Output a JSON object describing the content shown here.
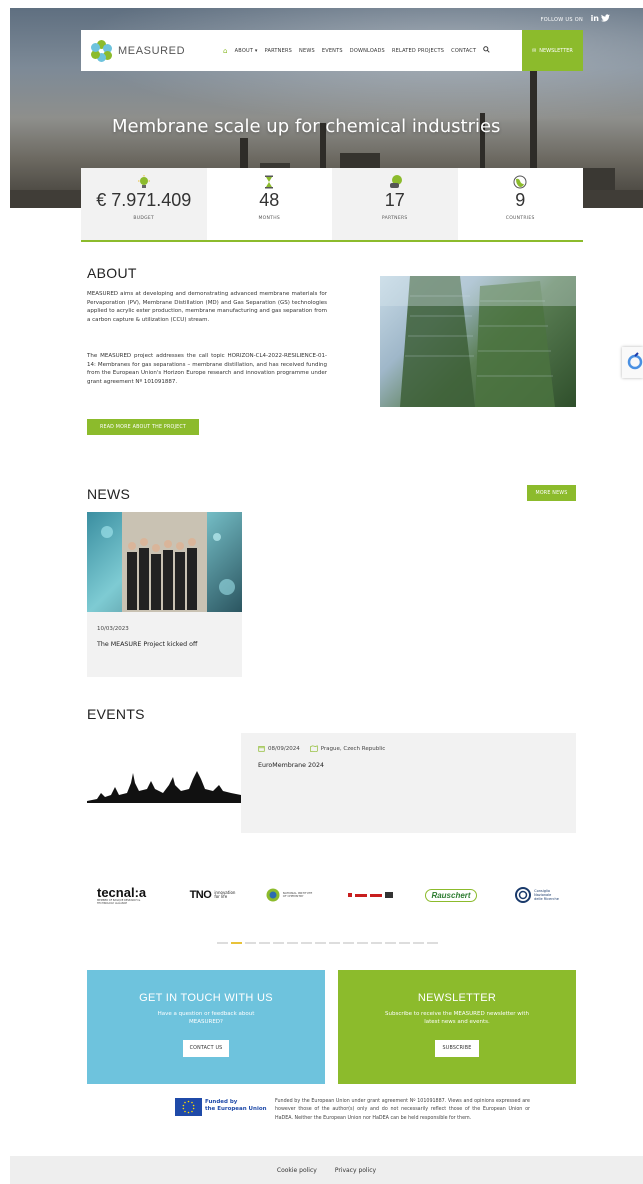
{
  "header": {
    "follow_label": "FOLLOW US ON",
    "logo_text": "MEASURED",
    "menu": [
      "ABOUT ▾",
      "PARTNERS",
      "NEWS",
      "EVENTS",
      "DOWNLOADS",
      "RELATED PROJECTS",
      "CONTACT"
    ],
    "newsletter_label": "NEWSLETTER",
    "hero_title": "Membrane scale up for chemical industries"
  },
  "stats": [
    {
      "value": "€ 7.971.409",
      "label": "BUDGET",
      "icon": "lightbulb-icon"
    },
    {
      "value": "48",
      "label": "MONTHS",
      "icon": "hourglass-icon"
    },
    {
      "value": "17",
      "label": "PARTNERS",
      "icon": "handshake-icon"
    },
    {
      "value": "9",
      "label": "COUNTRIES",
      "icon": "globe-icon"
    }
  ],
  "about": {
    "title": "ABOUT",
    "p1": "MEASURED aims at developing and demonstrating advanced membrane materials for Pervaporation (PV), Membrane Distillation (MD) and Gas Separation (GS) technologies applied to acrylic ester production, membrane manufacturing and gas separation from a carbon capture & utilization (CCU) stream.",
    "p2": "The MEASURED project addresses the call topic HORIZON-CL4-2022-RESILIENCE-01-14: Membranes for gas separations – membrane distillation, and has received funding from the European Union's Horizon Europe research and innovation programme under grant agreement Nº 101091887.",
    "button": "READ MORE ABOUT THE PROJECT"
  },
  "news": {
    "title": "NEWS",
    "more": "MORE NEWS",
    "items": [
      {
        "date": "10/03/2023",
        "headline": "The MEASURE Project kicked off"
      }
    ]
  },
  "events": {
    "title": "EVENTS",
    "items": [
      {
        "date": "08/09/2024",
        "location": "Prague, Czech Republic",
        "name": "EuroMembrane 2024"
      }
    ]
  },
  "partners": {
    "tecnalia": "tecnal:a",
    "tecnalia_sub": "MEMBER OF BASQUE RESEARCH & TECHNOLOGY ALLIANCE",
    "tno": "TNO",
    "tno_sub1": "innovation",
    "tno_sub2": "for life",
    "nic_text1": "NATIONAL INSTITUTE",
    "nic_text2": "OF CHEMISTRY",
    "rauschert": "Rauschert",
    "cnr1": "Consiglio",
    "cnr2": "Nazionale",
    "cnr3": "delle Ricerche"
  },
  "cta": {
    "contact_title": "GET IN TOUCH WITH US",
    "contact_text": "Have a question or feedback about MEASURED?",
    "contact_button": "CONTACT US",
    "newsletter_title": "NEWSLETTER",
    "newsletter_text": "Subscribe to receive the MEASURED newsletter with latest news and events.",
    "newsletter_button": "SUBSCRIBE",
    "contact_color": "#6ec3dd",
    "newsletter_color": "#8cbb2c"
  },
  "funding": {
    "eu_line1": "Funded by",
    "eu_line2": "the European Union",
    "disclaimer": "Funded by the European Union under grant agreement Nº 101091887. Views and opinions expressed are however those of the author(s) only and do not necessarily reflect those of the European Union or HaDEA. Neither the European Union nor HaDEA can be held responsible for them."
  },
  "footer": {
    "cookie": "Cookie policy",
    "privacy": "Privacy policy"
  },
  "colors": {
    "accent": "#8cbb2c",
    "contact": "#6ec3dd",
    "eu_blue": "#1f4aa8"
  }
}
